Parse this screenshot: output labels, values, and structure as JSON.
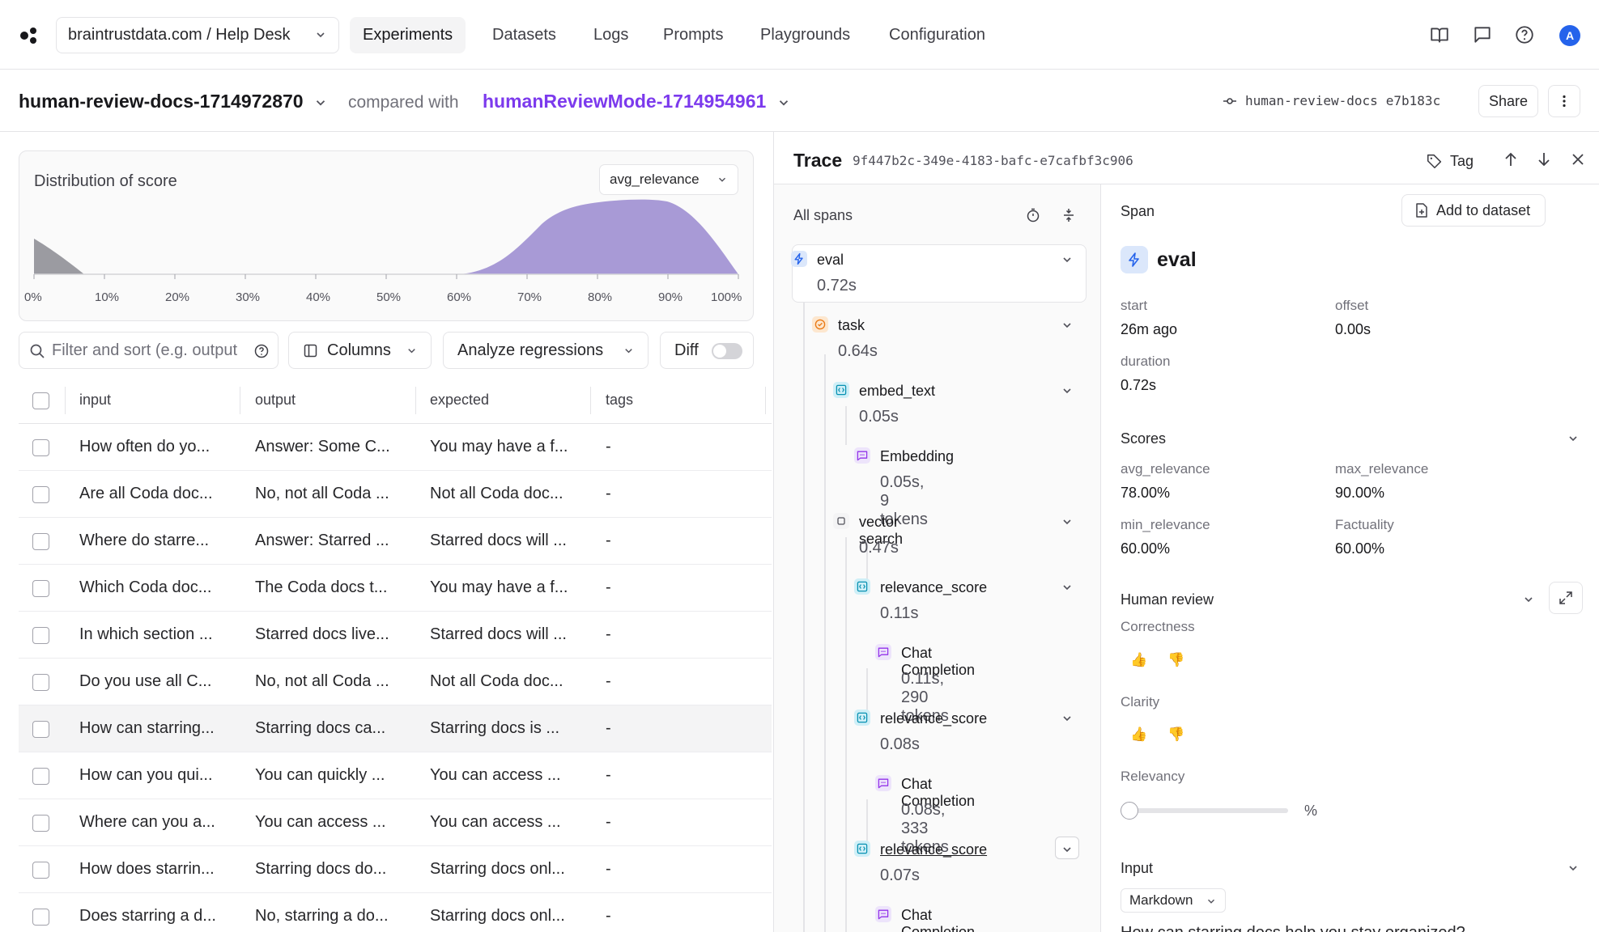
{
  "nav": {
    "project": "braintrustdata.com / Help Desk",
    "tabs": [
      "Experiments",
      "Datasets",
      "Logs",
      "Prompts",
      "Playgrounds",
      "Configuration"
    ],
    "avatar": "A"
  },
  "experiment": {
    "name": "human-review-docs-1714972870",
    "compared_label": "compared with",
    "base": "humanReviewMode-1714954961",
    "branch": "human-review-docs",
    "commit": "e7b183c",
    "share_label": "Share"
  },
  "distribution": {
    "title": "Distribution of score",
    "metric": "avg_relevance",
    "ticks": [
      "0%",
      "10%",
      "20%",
      "30%",
      "40%",
      "50%",
      "60%",
      "70%",
      "80%",
      "90%",
      "100%"
    ]
  },
  "toolbar": {
    "filter_placeholder": "Filter and sort (e.g. output",
    "columns_label": "Columns",
    "analyze_label": "Analyze regressions",
    "diff_label": "Diff"
  },
  "table": {
    "headers": [
      "input",
      "output",
      "expected",
      "tags"
    ],
    "rows": [
      [
        "How often do yo...",
        "Answer: Some C...",
        "You may have a f...",
        "-"
      ],
      [
        "Are all Coda doc...",
        "No, not all Coda ...",
        "Not all Coda doc...",
        "-"
      ],
      [
        "Where do starre...",
        "Answer: Starred ...",
        "Starred docs will ...",
        "-"
      ],
      [
        "Which Coda doc...",
        "The Coda docs t...",
        "You may have a f...",
        "-"
      ],
      [
        "In which section ...",
        "Starred docs live...",
        "Starred docs will ...",
        "-"
      ],
      [
        "Do you use all C...",
        "No, not all Coda ...",
        "Not all Coda doc...",
        "-"
      ],
      [
        "How can starring...",
        "Starring docs ca...",
        "Starring docs is ...",
        "-"
      ],
      [
        "How can you qui...",
        "You can quickly ...",
        "You can access ...",
        "-"
      ],
      [
        "Where can you a...",
        "You can access ...",
        "You can access ...",
        "-"
      ],
      [
        "How does starrin...",
        "Starring docs do...",
        "Starring docs onl...",
        "-"
      ],
      [
        "Does starring a d...",
        "No, starring a do...",
        "Starring docs onl...",
        "-"
      ]
    ]
  },
  "trace": {
    "title": "Trace",
    "id": "9f447b2c-349e-4183-bafc-e7cafbf3c906",
    "tag_label": "Tag",
    "spans_title": "All spans",
    "spans": [
      {
        "name": "eval",
        "time": "0.72s",
        "kind": "eval"
      },
      {
        "name": "task",
        "time": "0.64s",
        "kind": "task"
      },
      {
        "name": "embed_text",
        "time": "0.05s",
        "kind": "function"
      },
      {
        "name": "Embedding",
        "time": "0.05s, 9 tokens",
        "kind": "llm"
      },
      {
        "name": "vector search",
        "time": "0.47s",
        "kind": "generic"
      },
      {
        "name": "relevance_score",
        "time": "0.11s",
        "kind": "function"
      },
      {
        "name": "Chat Completion",
        "time": "0.11s, 290 tokens",
        "kind": "llm"
      },
      {
        "name": "relevance_score",
        "time": "0.08s",
        "kind": "function"
      },
      {
        "name": "Chat Completion",
        "time": "0.08s, 333 tokens",
        "kind": "llm"
      },
      {
        "name": "relevance_score",
        "time": "0.07s",
        "kind": "function"
      },
      {
        "name": "Chat Completion",
        "time": "",
        "kind": "llm"
      }
    ]
  },
  "detail": {
    "section": "Span",
    "add_label": "Add to dataset",
    "span_name": "eval",
    "start_label": "start",
    "start_value": "26m ago",
    "offset_label": "offset",
    "offset_value": "0.00s",
    "duration_label": "duration",
    "duration_value": "0.72s",
    "scores_title": "Scores",
    "scores": [
      {
        "name": "avg_relevance",
        "value": "78.00%"
      },
      {
        "name": "max_relevance",
        "value": "90.00%"
      },
      {
        "name": "min_relevance",
        "value": "60.00%"
      },
      {
        "name": "Factuality",
        "value": "60.00%"
      }
    ],
    "human_review_title": "Human review",
    "correctness_label": "Correctness",
    "clarity_label": "Clarity",
    "relevancy_label": "Relevancy",
    "relevancy_unit": "%",
    "relevancy_level": 0,
    "input_title": "Input",
    "format": "Markdown",
    "input_preview": "How can starring docs help you stay organized?"
  },
  "colors": {
    "accent": "#7c3aed",
    "histogram_current": "#a89ad6",
    "histogram_base": "#9b9ba1",
    "avatar": "#2563eb"
  }
}
